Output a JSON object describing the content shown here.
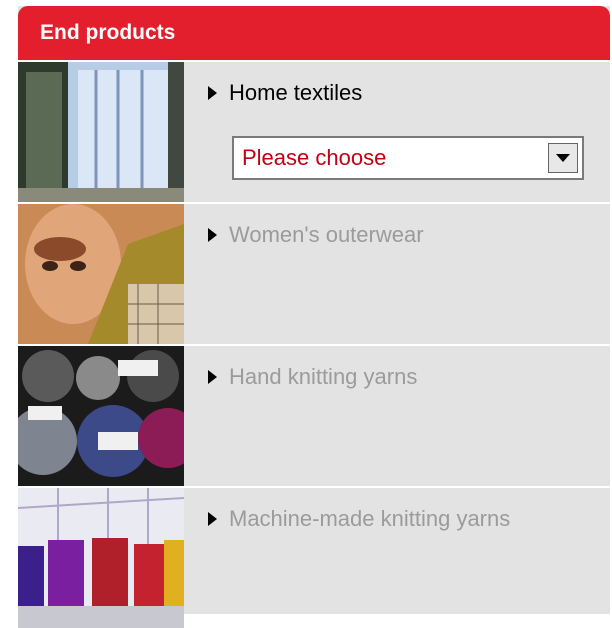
{
  "panel": {
    "title": "End products"
  },
  "rows": [
    {
      "label": "Home textiles",
      "enabled": true,
      "image": "home-textiles-photo"
    },
    {
      "label": "Women's outerwear",
      "enabled": false,
      "image": "womens-outerwear-photo"
    },
    {
      "label": "Hand knitting yarns",
      "enabled": false,
      "image": "hand-knitting-yarns-photo"
    },
    {
      "label": "Machine-made knitting yarns",
      "enabled": false,
      "image": "machine-knitting-yarns-photo"
    }
  ],
  "select": {
    "value": "Please choose"
  },
  "colors": {
    "header": "#e41f2d",
    "panel_bg": "#e3e3e3",
    "select_text": "#c40014",
    "disabled_text": "#9b9b9b"
  }
}
